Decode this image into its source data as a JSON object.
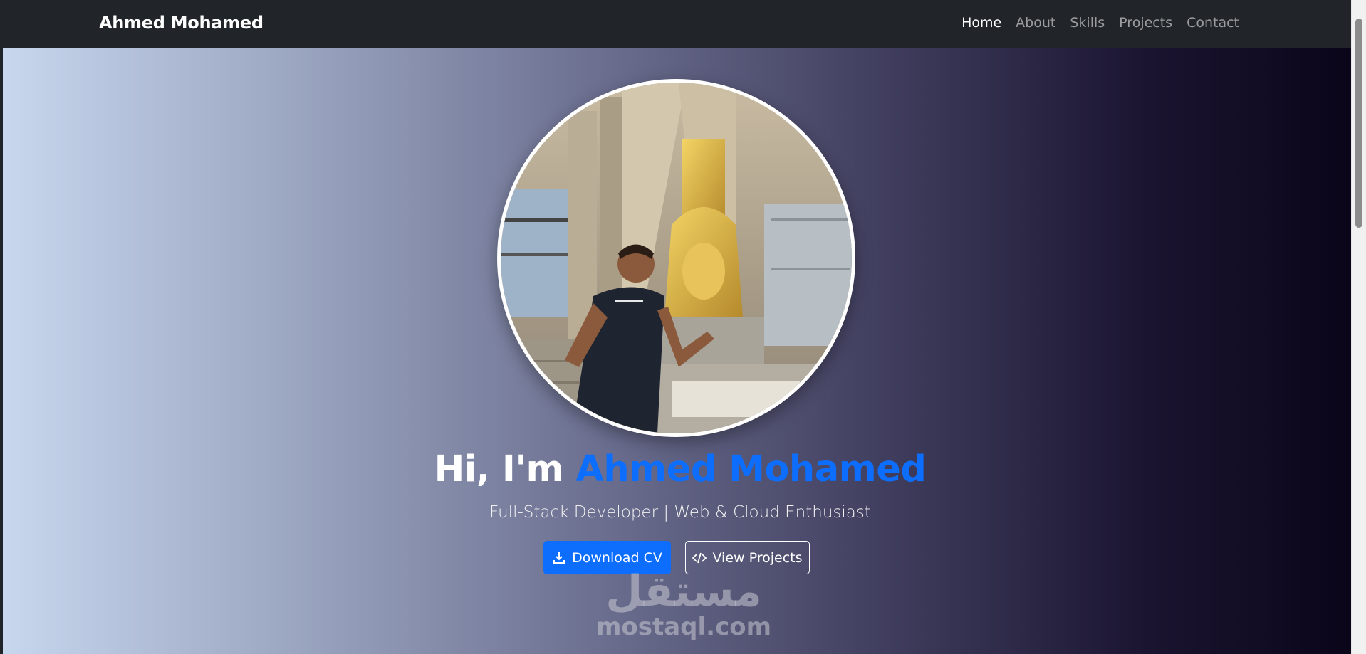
{
  "navbar": {
    "brand": "Ahmed Mohamed",
    "links": [
      {
        "label": "Home",
        "active": true
      },
      {
        "label": "About",
        "active": false
      },
      {
        "label": "Skills",
        "active": false
      },
      {
        "label": "Projects",
        "active": false
      },
      {
        "label": "Contact",
        "active": false
      }
    ]
  },
  "hero": {
    "greeting": "Hi, I'm",
    "name": "Ahmed Mohamed",
    "subtitle": "Full-Stack Developer | Web & Cloud Enthusiast",
    "buttons": {
      "download_cv": {
        "label": "Download CV",
        "icon": "download-icon"
      },
      "view_projects": {
        "label": "View Projects",
        "icon": "code-icon"
      }
    },
    "avatar_alt": "profile-photo"
  },
  "watermark": {
    "arabic": "مستقل",
    "latin": "mostaql.com"
  },
  "colors": {
    "navbar_bg": "#212529",
    "accent": "#0d6efd",
    "gradient_start": "#c8d6ee",
    "gradient_end": "#0b051a"
  }
}
